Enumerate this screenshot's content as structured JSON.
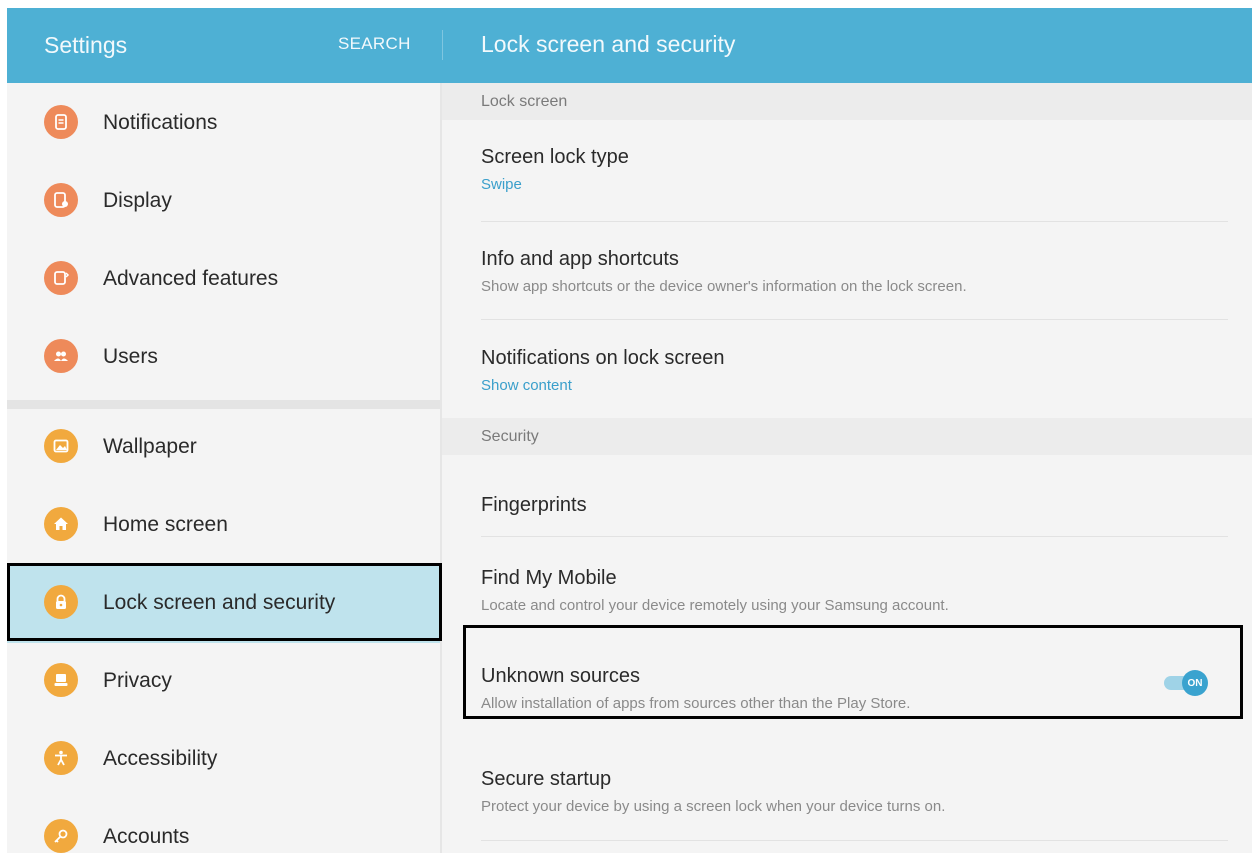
{
  "header": {
    "app_title": "Settings",
    "search_label": "SEARCH",
    "page_title": "Lock screen and security",
    "color": "#4eb0d4"
  },
  "sidebar": {
    "items": [
      {
        "label": "Notifications",
        "icon": "notifications-icon",
        "color": "#ee8a5a"
      },
      {
        "label": "Display",
        "icon": "display-icon",
        "color": "#ee8a5a"
      },
      {
        "label": "Advanced features",
        "icon": "advanced-features-icon",
        "color": "#ee8a5a"
      },
      {
        "label": "Users",
        "icon": "users-icon",
        "color": "#ee8a5a"
      },
      {
        "label": "Wallpaper",
        "icon": "wallpaper-icon",
        "color": "#f1a93e"
      },
      {
        "label": "Home screen",
        "icon": "home-icon",
        "color": "#f1a93e"
      },
      {
        "label": "Lock screen and security",
        "icon": "lock-icon",
        "color": "#f1a93e",
        "selected": true
      },
      {
        "label": "Privacy",
        "icon": "privacy-icon",
        "color": "#f1a93e"
      },
      {
        "label": "Accessibility",
        "icon": "accessibility-icon",
        "color": "#f1a93e"
      },
      {
        "label": "Accounts",
        "icon": "key-icon",
        "color": "#f1a93e"
      }
    ]
  },
  "main": {
    "sections": [
      {
        "header": "Lock screen",
        "rows": [
          {
            "title": "Screen lock type",
            "subtitle": "Swipe",
            "subtitle_style": "blue"
          },
          {
            "title": "Info and app shortcuts",
            "subtitle": "Show app shortcuts or the device owner's information on the lock screen."
          },
          {
            "title": "Notifications on lock screen",
            "subtitle": "Show content",
            "subtitle_style": "blue"
          }
        ]
      },
      {
        "header": "Security",
        "rows": [
          {
            "title": "Fingerprints"
          },
          {
            "title": "Find My Mobile",
            "subtitle": "Locate and control your device remotely using your Samsung account."
          },
          {
            "title": "Unknown sources",
            "subtitle": "Allow installation of apps from sources other than the Play Store.",
            "toggle": "ON"
          },
          {
            "title": "Secure startup",
            "subtitle": "Protect your device by using a screen lock when your device turns on."
          }
        ]
      }
    ],
    "accent_color": "#3a9fcb"
  }
}
